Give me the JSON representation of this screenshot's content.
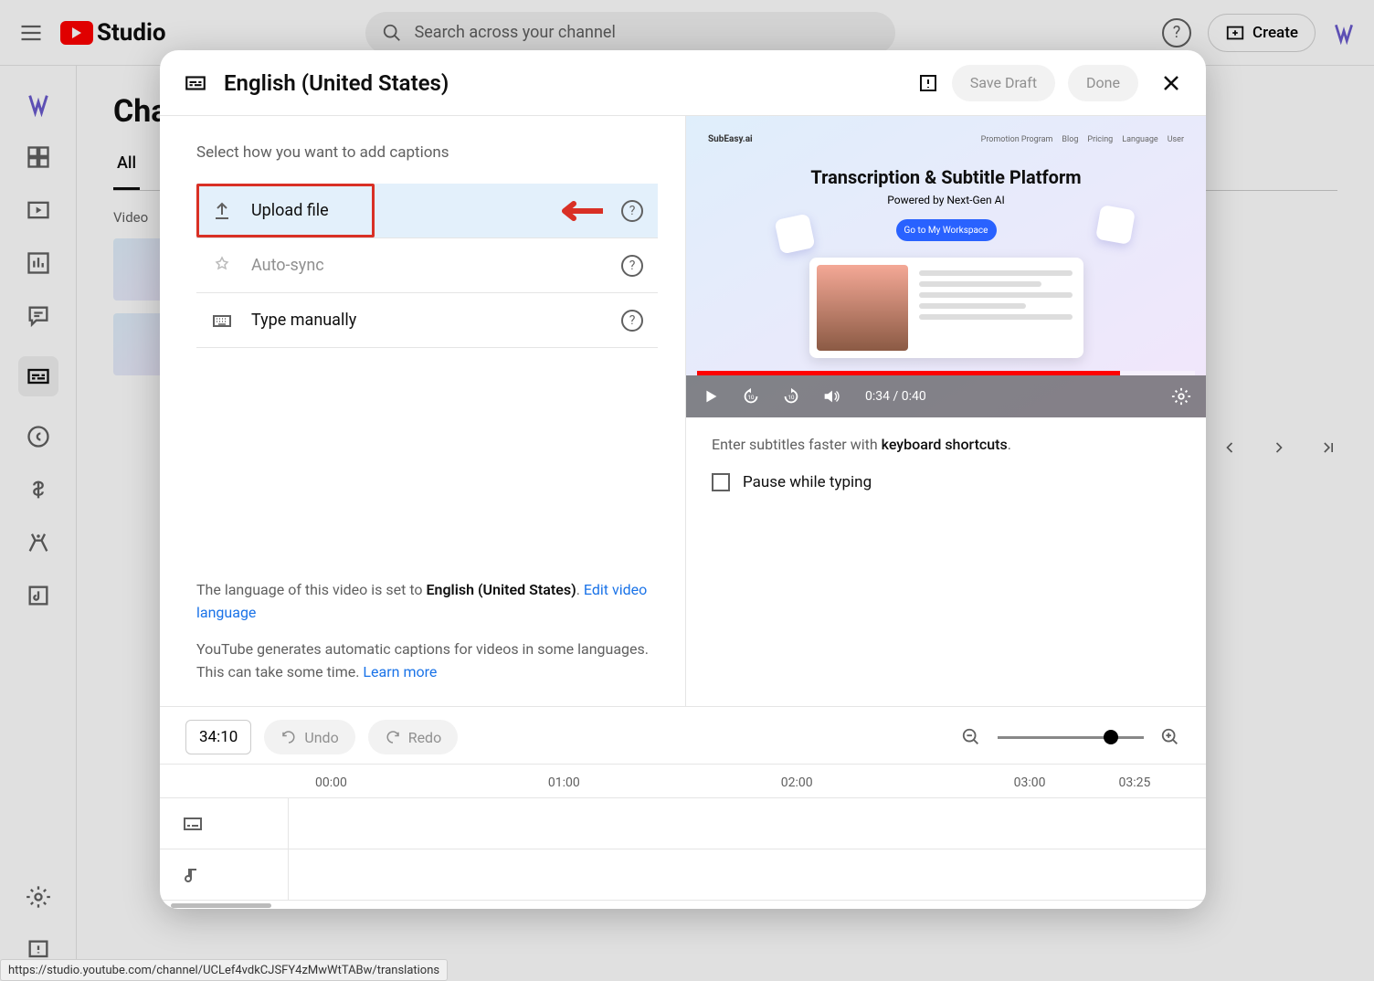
{
  "header": {
    "studio_label": "Studio",
    "search_placeholder": "Search across your channel",
    "create_label": "Create"
  },
  "page": {
    "title": "Cha",
    "tab_all": "All",
    "video_col": "Video"
  },
  "modal": {
    "title": "English (United States)",
    "save_draft": "Save Draft",
    "done": "Done",
    "select_text": "Select how you want to add captions",
    "options": {
      "upload": "Upload file",
      "autosync": "Auto-sync",
      "type": "Type manually"
    },
    "lang_note_prefix": "The language of this video is set to ",
    "lang_note_lang": "English (United States)",
    "lang_note_dot": ". ",
    "edit_video_language": "Edit video language",
    "auto_note": "YouTube generates automatic captions for videos in some languages. This can take some time. ",
    "learn_more": "Learn more",
    "preview": {
      "brand": "SubEasy.ai",
      "menu": [
        "Promotion Program",
        "Blog",
        "Pricing",
        "Language",
        "User"
      ],
      "headline": "Transcription & Subtitle Platform",
      "sub": "Powered by Next-Gen AI",
      "cta": "Go to My Workspace"
    },
    "player": {
      "time": "0:34 / 0:40",
      "progress_pct": 85
    },
    "hint_prefix": "Enter subtitles faster with ",
    "hint_link": "keyboard shortcuts",
    "hint_dot": ".",
    "pause_label": "Pause while typing",
    "footer": {
      "timecode": "34:10",
      "undo": "Undo",
      "redo": "Redo"
    },
    "timeline": {
      "ticks": [
        "00:00",
        "01:00",
        "02:00",
        "03:00",
        "03:25"
      ]
    }
  },
  "status_url": "https://studio.youtube.com/channel/UCLef4vdkCJSFY4zMwWtTABw/translations"
}
